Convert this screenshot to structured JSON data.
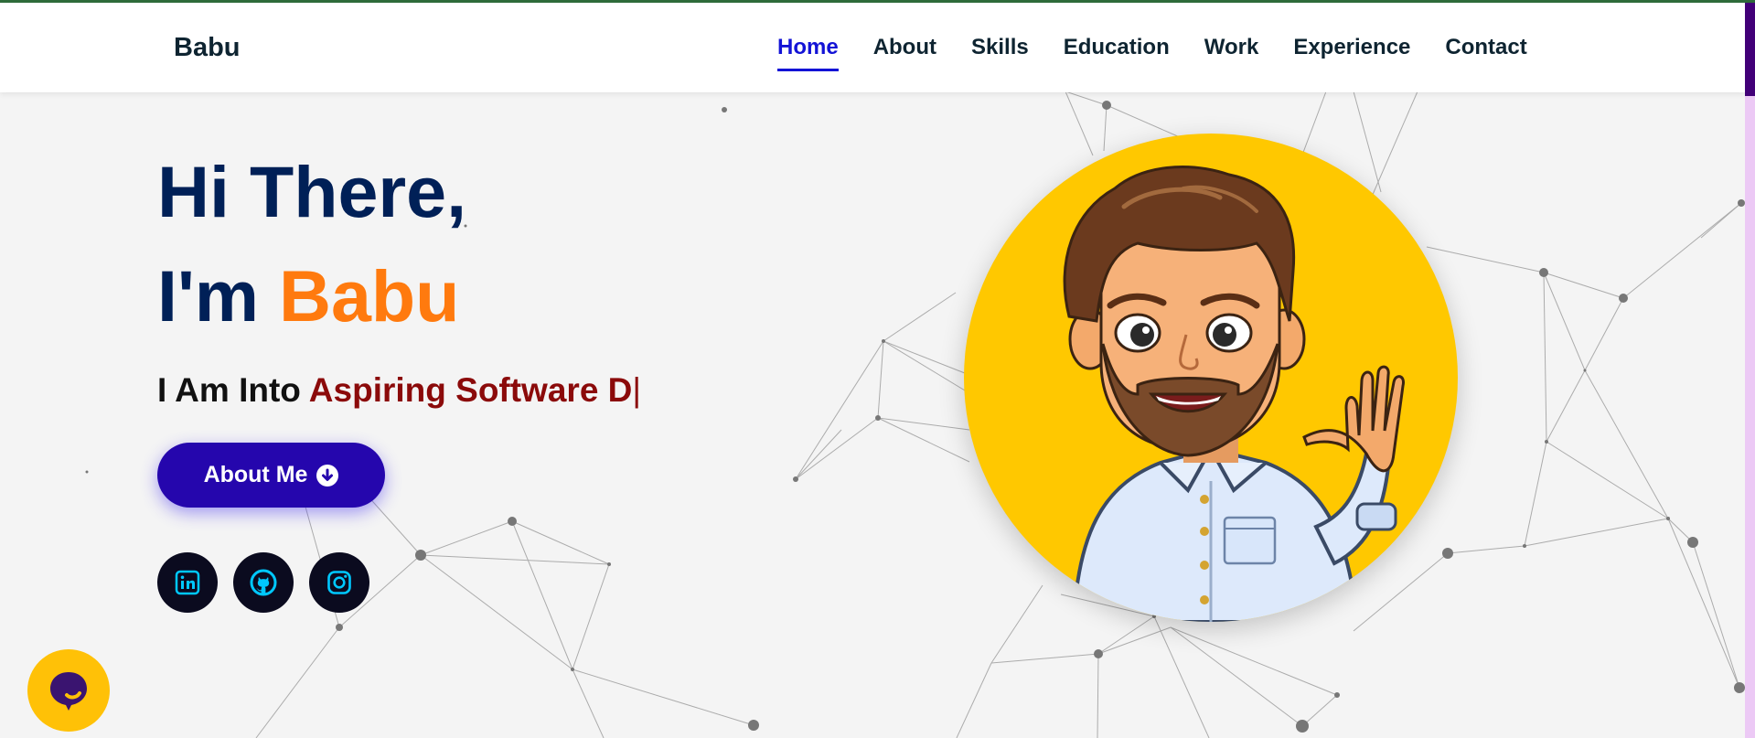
{
  "header": {
    "brand": "Babu",
    "nav": [
      {
        "label": "Home",
        "active": true
      },
      {
        "label": "About",
        "active": false
      },
      {
        "label": "Skills",
        "active": false
      },
      {
        "label": "Education",
        "active": false
      },
      {
        "label": "Work",
        "active": false
      },
      {
        "label": "Experience",
        "active": false
      },
      {
        "label": "Contact",
        "active": false
      }
    ]
  },
  "hero": {
    "greeting": "Hi There,",
    "intro_prefix": "I'm ",
    "name": "Babu",
    "tagline_prefix": "I Am Into ",
    "tagline_typed": "Aspiring Software D",
    "cursor": "|",
    "button_label": "About Me",
    "button_icon": "arrow-circle-down-icon",
    "socials": [
      {
        "icon": "linkedin-icon"
      },
      {
        "icon": "github-icon"
      },
      {
        "icon": "instagram-icon"
      }
    ],
    "avatar": "bitmoji-avatar-waving"
  },
  "chat": {
    "icon": "chat-bubble-icon"
  },
  "colors": {
    "top_line": "#2e6b3a",
    "nav_active": "#1313d6",
    "heading": "#002057",
    "name_accent": "#ff7a0e",
    "typed_text": "#8b0a0a",
    "button_bg": "#2506ad",
    "avatar_bg": "#ffc800",
    "social_bg": "#0b0b1f",
    "social_icon": "#00c8ff",
    "chat_bg": "#ffc107",
    "scroll_thumb": "#420078",
    "scroll_track": "#ecc9f5"
  }
}
